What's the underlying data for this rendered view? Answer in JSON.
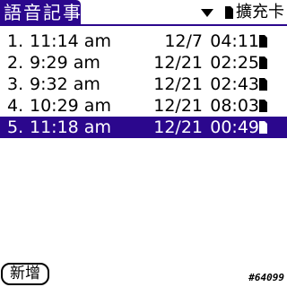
{
  "app": {
    "title": "語音記事"
  },
  "category": {
    "selected": "擴充卡",
    "dropdown_icon": "triangle-down-icon",
    "storage_icon": "sd-card-icon"
  },
  "memos": [
    {
      "number": "1.",
      "time": "11:14 am",
      "date": "12/7",
      "duration": "04:11",
      "selected": false
    },
    {
      "number": "2.",
      "time": "9:29 am",
      "date": "12/21",
      "duration": "02:25",
      "selected": false
    },
    {
      "number": "3.",
      "time": "9:32 am",
      "date": "12/21",
      "duration": "02:43",
      "selected": false
    },
    {
      "number": "4.",
      "time": "10:29 am",
      "date": "12/21",
      "duration": "08:03",
      "selected": false
    },
    {
      "number": "5.",
      "time": "11:18 am",
      "date": "12/21",
      "duration": "00:49",
      "selected": true
    }
  ],
  "footer": {
    "new_button_label": "新增",
    "free_count": "#64099"
  },
  "colors": {
    "accent": "#2b078d",
    "background": "#ffffff",
    "text": "#000000"
  }
}
